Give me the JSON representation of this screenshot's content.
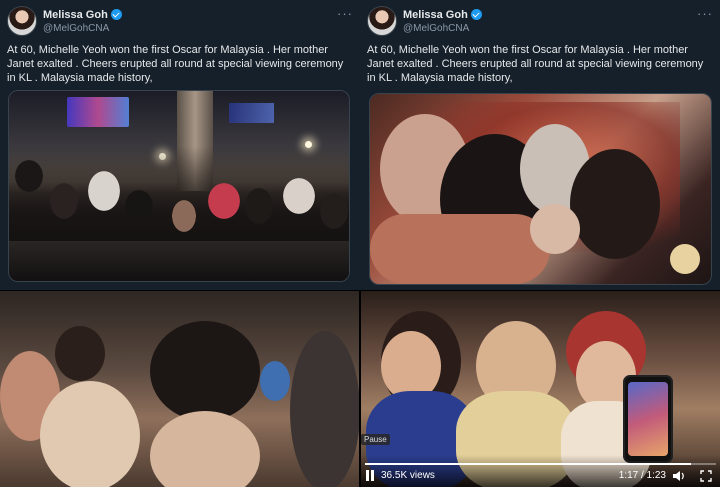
{
  "tweets": [
    {
      "display_name": "Melissa Goh",
      "handle": "@MelGohCNA",
      "more_label": "···",
      "text": "At 60, Michelle Yeoh won the first Oscar for Malaysia . Her mother Janet exalted . Cheers erupted all round at special viewing ceremony in KL . Malaysia made history,"
    },
    {
      "display_name": "Melissa Goh",
      "handle": "@MelGohCNA",
      "more_label": "···",
      "text": "At 60, Michelle Yeoh won the first Oscar for Malaysia . Her mother Janet exalted . Cheers erupted all round at special viewing ceremony in KL . Malaysia made history,"
    }
  ],
  "video": {
    "pause_label": "Pause",
    "views": "36.5K views",
    "time": "1:17 / 1:23",
    "progress_fraction": 0.928
  },
  "colors": {
    "tweet_bg": "#15202b",
    "text": "#e7e9ea",
    "muted": "#8b98a5",
    "verified": "#1d9bf0"
  },
  "icons": [
    "verified-icon",
    "more-icon",
    "play-pause-icon",
    "volume-icon",
    "fullscreen-icon"
  ]
}
